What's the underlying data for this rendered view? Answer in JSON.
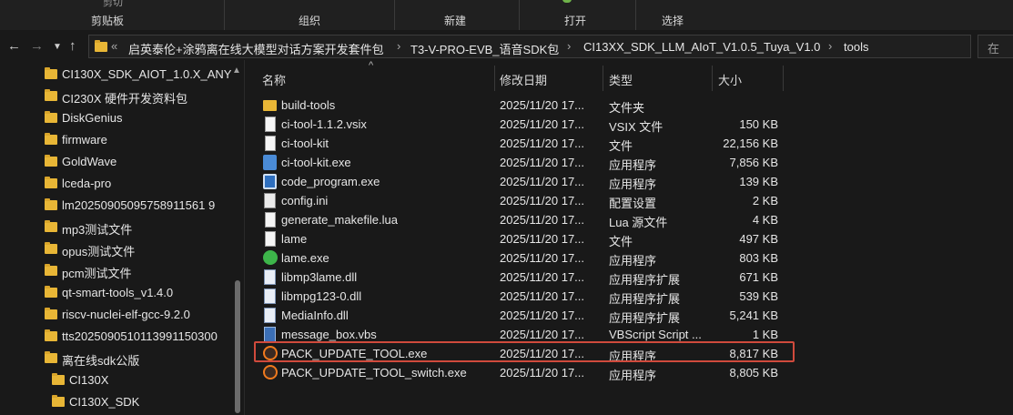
{
  "ribbon": {
    "groups": [
      "剪贴板",
      "组织",
      "新建",
      "打开",
      "选择"
    ],
    "clipped_top": "剪切"
  },
  "address": {
    "overflow": "«",
    "crumbs": [
      "启英泰伦+涂鸦离在线大模型对话方案开发套件包",
      "T3-V-PRO-EVB_语音SDK包",
      "CI13XX_SDK_LLM_AIoT_V1.0.5_Tuya_V1.0",
      "tools"
    ],
    "search_placeholder": "在"
  },
  "nav": {
    "items": [
      {
        "label": "CI130X_SDK_AIOT_1.0.X_ANY"
      },
      {
        "label": "CI230X 硬件开发资料包"
      },
      {
        "label": "DiskGenius"
      },
      {
        "label": "firmware"
      },
      {
        "label": "GoldWave"
      },
      {
        "label": "lceda-pro"
      },
      {
        "label": "lm20250905095758911561 9"
      },
      {
        "label": "mp3测试文件"
      },
      {
        "label": "opus测试文件"
      },
      {
        "label": "pcm测试文件"
      },
      {
        "label": "qt-smart-tools_v1.4.0"
      },
      {
        "label": "riscv-nuclei-elf-gcc-9.2.0"
      },
      {
        "label": "tts2025090510113991150300"
      },
      {
        "label": "离在线sdk公版"
      },
      {
        "label": "CI130X"
      },
      {
        "label": "CI130X_SDK"
      }
    ]
  },
  "columns": {
    "name": "名称",
    "date": "修改日期",
    "type": "类型",
    "size": "大小"
  },
  "files": [
    {
      "name": "build-tools",
      "date": "2025/11/20 17...",
      "type": "文件夹",
      "size": "",
      "icon": "folder-icon"
    },
    {
      "name": "ci-tool-1.1.2.vsix",
      "date": "2025/11/20 17...",
      "type": "VSIX 文件",
      "size": "150 KB",
      "icon": "document-icon"
    },
    {
      "name": "ci-tool-kit",
      "date": "2025/11/20 17...",
      "type": "文件",
      "size": "22,156 KB",
      "icon": "document-icon"
    },
    {
      "name": "ci-tool-kit.exe",
      "date": "2025/11/20 17...",
      "type": "应用程序",
      "size": "7,856 KB",
      "icon": "python-exe-icon"
    },
    {
      "name": "code_program.exe",
      "date": "2025/11/20 17...",
      "type": "应用程序",
      "size": "139 KB",
      "icon": "app-window-icon"
    },
    {
      "name": "config.ini",
      "date": "2025/11/20 17...",
      "type": "配置设置",
      "size": "2 KB",
      "icon": "config-file-icon"
    },
    {
      "name": "generate_makefile.lua",
      "date": "2025/11/20 17...",
      "type": "Lua 源文件",
      "size": "4 KB",
      "icon": "document-icon"
    },
    {
      "name": "lame",
      "date": "2025/11/20 17...",
      "type": "文件",
      "size": "497 KB",
      "icon": "document-icon"
    },
    {
      "name": "lame.exe",
      "date": "2025/11/20 17...",
      "type": "应用程序",
      "size": "803 KB",
      "icon": "green-app-icon"
    },
    {
      "name": "libmp3lame.dll",
      "date": "2025/11/20 17...",
      "type": "应用程序扩展",
      "size": "671 KB",
      "icon": "dll-icon"
    },
    {
      "name": "libmpg123-0.dll",
      "date": "2025/11/20 17...",
      "type": "应用程序扩展",
      "size": "539 KB",
      "icon": "dll-icon"
    },
    {
      "name": "MediaInfo.dll",
      "date": "2025/11/20 17...",
      "type": "应用程序扩展",
      "size": "5,241 KB",
      "icon": "dll-icon"
    },
    {
      "name": "message_box.vbs",
      "date": "2025/11/20 17...",
      "type": "VBScript Script ...",
      "size": "1 KB",
      "icon": "vbs-script-icon"
    },
    {
      "name": "PACK_UPDATE_TOOL.exe",
      "date": "2025/11/20 17...",
      "type": "应用程序",
      "size": "8,817 KB",
      "icon": "pack-tool-icon",
      "highlighted": true
    },
    {
      "name": "PACK_UPDATE_TOOL_switch.exe",
      "date": "2025/11/20 17...",
      "type": "应用程序",
      "size": "8,805 KB",
      "icon": "pack-tool-icon"
    }
  ],
  "colors": {
    "background": "#191919",
    "highlight_border": "#d04a3c",
    "folder": "#e8b636"
  }
}
